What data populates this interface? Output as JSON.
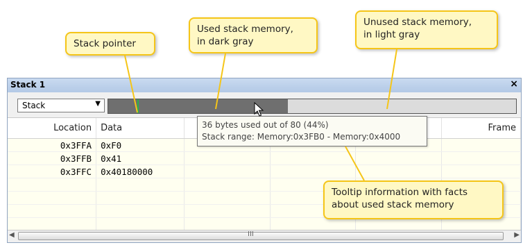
{
  "callouts": {
    "stack_pointer": "Stack pointer",
    "used_memory": [
      "Used stack memory,",
      "in dark gray"
    ],
    "unused_memory": [
      "Unused stack memory,",
      "in light gray"
    ],
    "tooltip_info": [
      "Tooltip information with facts",
      "about used stack memory"
    ]
  },
  "window": {
    "title": "Stack 1",
    "close_label": "×"
  },
  "toolbar": {
    "dropdown_value": "Stack",
    "stack_used_fraction": 0.44
  },
  "tooltip": {
    "line1": "36 bytes used out of 80 (44%)",
    "line2": "Stack range: Memory:0x3FB0 - Memory:0x4000"
  },
  "table": {
    "headers": [
      "Location",
      "Data",
      "",
      "",
      "",
      "Frame"
    ],
    "rows": [
      {
        "location": "0x3FFA",
        "data": "0xF0"
      },
      {
        "location": "0x3FFB",
        "data": "0x41"
      },
      {
        "location": "0x3FFC",
        "data": "0x40180000"
      }
    ]
  },
  "scrollbar": {
    "grip_label": "III"
  },
  "colors": {
    "callout_bg": "#fff8c4",
    "callout_border": "#f5c518",
    "used_bar": "#6f6f6f",
    "unused_bar": "#dcdcdc",
    "stack_pointer_line": "#2bb24a",
    "highlight_cell": "#22e022"
  }
}
